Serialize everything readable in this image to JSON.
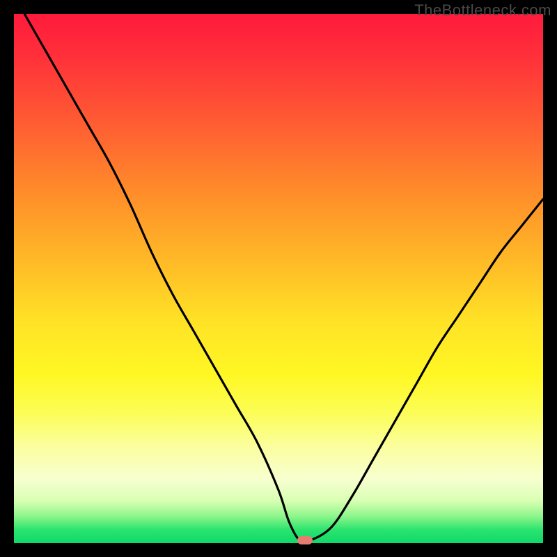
{
  "watermark": "TheBottleneck.com",
  "colors": {
    "frame_bg": "#000000",
    "curve_stroke": "#000000",
    "min_marker": "#e87b6f",
    "gradient_top": "#ff1a3c",
    "gradient_bottom": "#0fd96a"
  },
  "chart_data": {
    "type": "line",
    "title": "",
    "xlabel": "",
    "ylabel": "",
    "xlim": [
      0,
      100
    ],
    "ylim": [
      0,
      100
    ],
    "grid": false,
    "legend": false,
    "series": [
      {
        "name": "bottleneck-curve",
        "x": [
          2,
          6,
          10,
          14,
          18,
          22,
          26,
          30,
          34,
          38,
          42,
          46,
          50,
          52,
          54,
          56,
          60,
          64,
          68,
          72,
          76,
          80,
          84,
          88,
          92,
          96,
          100
        ],
        "y": [
          100,
          93,
          86,
          79,
          72,
          64,
          55,
          47,
          40,
          33,
          26,
          19,
          10,
          4,
          0.5,
          0.5,
          3,
          9,
          16,
          23,
          30,
          37,
          43,
          49,
          55,
          60,
          65
        ]
      }
    ],
    "min_marker": {
      "x": 55,
      "y": 0.5
    },
    "background_gradient": {
      "direction": "vertical",
      "stops": [
        {
          "pos": 0.0,
          "color": "#ff1a3c"
        },
        {
          "pos": 0.2,
          "color": "#ff5a33"
        },
        {
          "pos": 0.46,
          "color": "#ffb727"
        },
        {
          "pos": 0.68,
          "color": "#fff723"
        },
        {
          "pos": 0.88,
          "color": "#f7ffd0"
        },
        {
          "pos": 0.95,
          "color": "#8bf58a"
        },
        {
          "pos": 1.0,
          "color": "#0fd96a"
        }
      ]
    }
  }
}
